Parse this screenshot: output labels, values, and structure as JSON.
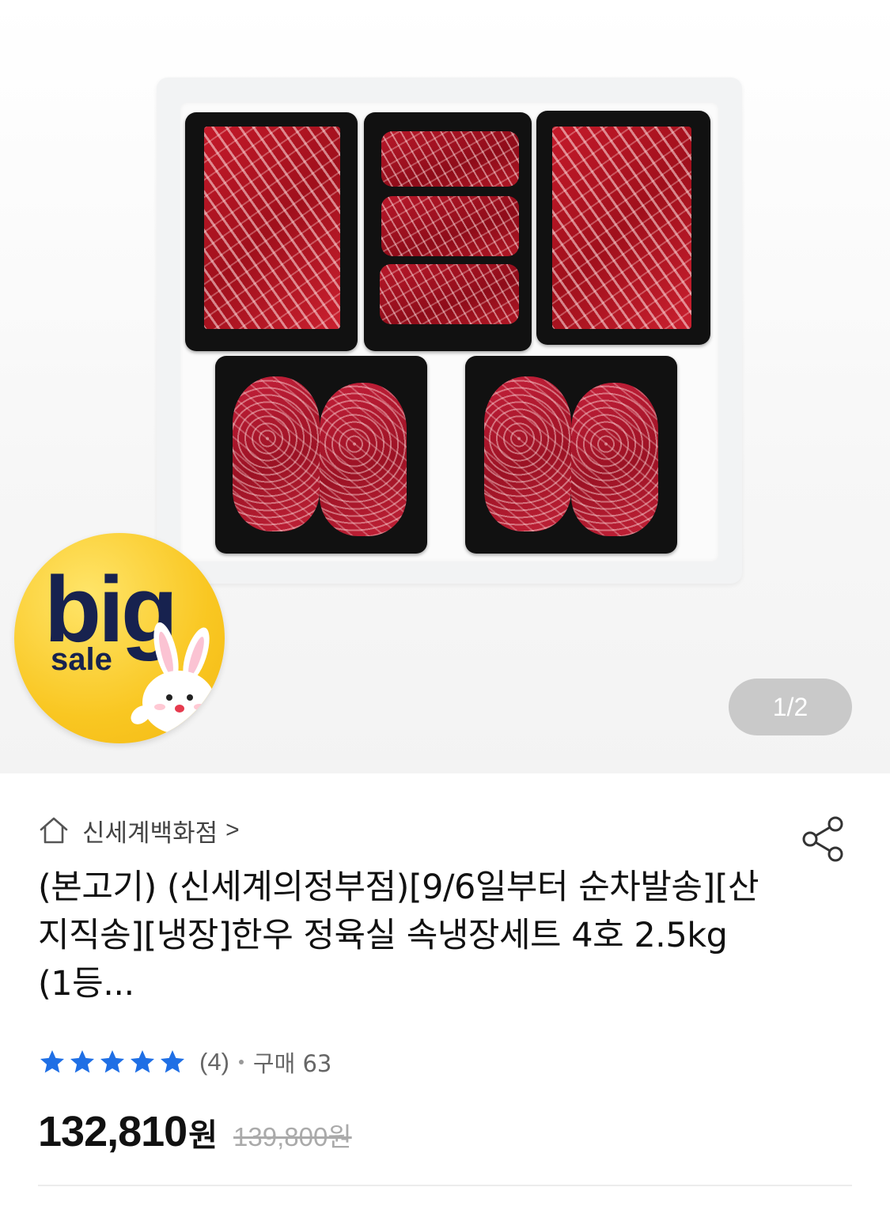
{
  "gallery": {
    "pager": "1/2",
    "badge": {
      "line1": "big",
      "line2": "sale"
    }
  },
  "shop": {
    "name": "신세계백화점",
    "chevron": ">"
  },
  "product": {
    "title": "(본고기) (신세계의정부점)[9/6일부터 순차발송][산지직송][냉장]한우 정육실 속냉장세트 4호 2.5kg (1등...",
    "rating": {
      "stars": 5,
      "review_count": "(4)",
      "purchase": "구매 63"
    },
    "price": {
      "sale": "132,810",
      "sale_unit": "원",
      "original": "139,800원"
    }
  },
  "colors": {
    "star": "#1f6fe5",
    "badge": "#f9c722",
    "badge_text": "#17224f"
  },
  "icons": {
    "home": "home-icon",
    "share": "share-icon",
    "star": "star-icon",
    "rabbit": "rabbit-icon"
  }
}
